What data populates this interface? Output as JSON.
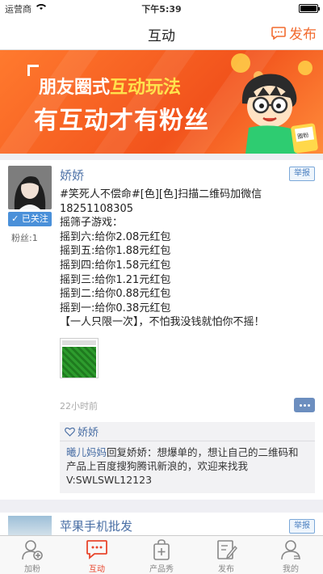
{
  "status": {
    "carrier": "运营商",
    "time": "下午5:39"
  },
  "nav": {
    "title": "互动",
    "publish_label": "发布"
  },
  "banner": {
    "line1_a": "朋友圈式",
    "line1_b": "互动玩法",
    "line2": "有互动才有粉丝",
    "phone_label": "圈粉"
  },
  "post": {
    "username": "娇娇",
    "follow_label": "✓ 已关注",
    "fans_label": "粉丝:1",
    "report_label": "举报",
    "text": "#笑死人不偿命#[色][色]扫描二维码加微信\n18251108305\n摇筛子游戏：\n摇到六:给你2.08元红包\n摇到五:给你1.88元红包\n摇到四:给你1.58元红包\n摇到三:给你1.21元红包\n摇到二:给你0.88元红包\n摇到一:给你0.38元红包\n【一人只限一次】，不怕我没钱就怕你不摇！",
    "timestamp": "22小时前",
    "likes": "娇娇",
    "comment": {
      "author": "曦儿妈妈",
      "reply_word": "回复",
      "target": "娇娇",
      "text": "：想爆单的，想让自己的二维码和产品上百度搜狗腾讯新浪的，欢迎来找我V:SWLSWL12123"
    }
  },
  "post2": {
    "username": "苹果手机批发",
    "report_label": "举报"
  },
  "tabs": [
    {
      "label": "加粉",
      "icon": "add-user-icon"
    },
    {
      "label": "互动",
      "icon": "chat-icon"
    },
    {
      "label": "产品秀",
      "icon": "bag-icon"
    },
    {
      "label": "发布",
      "icon": "edit-icon"
    },
    {
      "label": "我的",
      "icon": "profile-icon"
    }
  ],
  "colors": {
    "accent": "#f26b2f",
    "active_tab": "#e8452c",
    "link": "#4a6fa5",
    "follow": "#4a90d9"
  }
}
